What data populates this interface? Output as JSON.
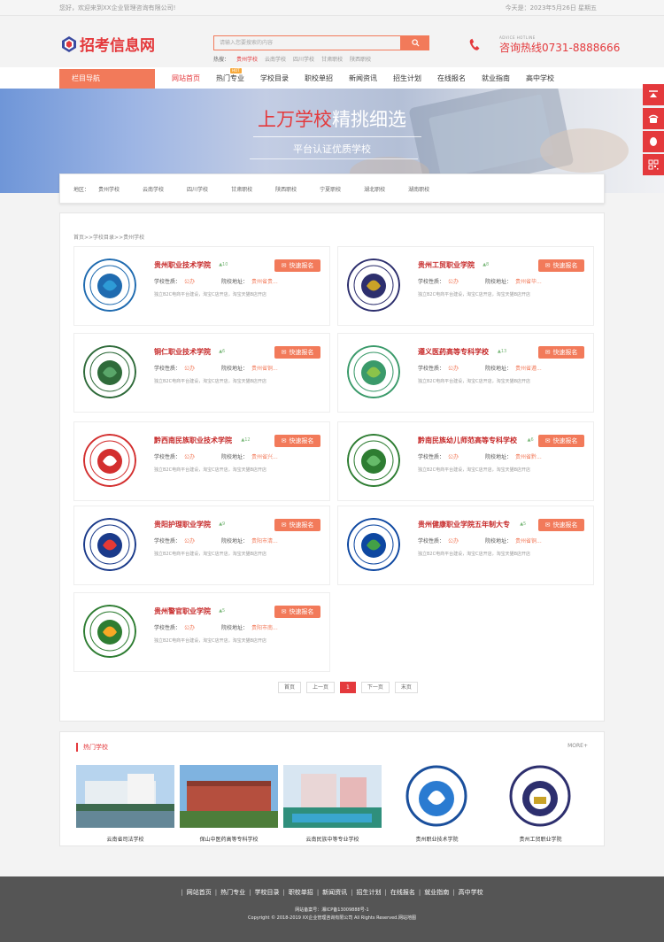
{
  "topbar": {
    "welcome": "您好，欢迎来到XX企业管理咨询有限公司!",
    "date": "今天是：2023年5月26日 星期五"
  },
  "logo": {
    "text": "招考信息网"
  },
  "search": {
    "placeholder": "请输入您要搜索的内容",
    "hot_label": "热搜：",
    "hot_items": [
      "贵州学校",
      "云南学校",
      "四川学校",
      "甘肃职校",
      "陕西职校"
    ]
  },
  "phone": {
    "small": "ADVICE HOTLINE",
    "label": "咨询热线",
    "number": "0731-8888666"
  },
  "nav": {
    "side_label": "栏目导航",
    "hot_badge": "HOT",
    "items": [
      "网站首页",
      "热门专业",
      "学校目录",
      "职校单招",
      "新闻资讯",
      "招生计划",
      "在线报名",
      "就业指南",
      "高中学校"
    ]
  },
  "banner": {
    "title_red": "上万学校",
    "title_white": "精挑细选",
    "subtitle": "平台认证优质学校"
  },
  "region": {
    "label": "地区：",
    "items": [
      "贵州学校",
      "云南学校",
      "四川学校",
      "甘肃职校",
      "陕西职校",
      "宁夏职校",
      "湖北职校",
      "湖南职校"
    ]
  },
  "breadcrumb": "首页>>学校目录>>贵州学校",
  "card_labels": {
    "button": "快速报名",
    "nature": "学校性质：",
    "address": "院校地址：",
    "desc": "独立B2C电商平台建设，淘宝C店开店，淘宝天猫B店开店"
  },
  "schools": [
    {
      "name": "贵州职业技术学院",
      "count": "10",
      "nature": "公办",
      "address": "贵州省贵..."
    },
    {
      "name": "贵州工贸职业学院",
      "count": "8",
      "nature": "公办",
      "address": "贵州省毕..."
    },
    {
      "name": "铜仁职业技术学院",
      "count": "6",
      "nature": "公办",
      "address": "贵州省铜..."
    },
    {
      "name": "遵义医药高等专科学校",
      "count": "13",
      "nature": "公办",
      "address": "贵州省遵..."
    },
    {
      "name": "黔西南民族职业技术学院",
      "count": "12",
      "nature": "公办",
      "address": "贵州省兴..."
    },
    {
      "name": "黔南民族幼儿师范高等专科学校",
      "count": "6",
      "nature": "公办",
      "address": "贵州省黔..."
    },
    {
      "name": "贵阳护理职业学院",
      "count": "9",
      "nature": "公办",
      "address": "贵阳市清..."
    },
    {
      "name": "贵州健康职业学院五年制大专",
      "count": "5",
      "nature": "公办",
      "address": "贵州省铜..."
    },
    {
      "name": "贵州警官职业学院",
      "count": "5",
      "nature": "公办",
      "address": "贵阳市南..."
    }
  ],
  "pager": [
    "首页",
    "上一页",
    "1",
    "下一页",
    "末页"
  ],
  "hot_schools": {
    "title": "热门学校",
    "more": "MORE+",
    "items": [
      "云南省司法学校",
      "保山中医药高等专科学校",
      "云南民族中等专业学校",
      "贵州职业技术学院",
      "贵州工贸职业学院"
    ]
  },
  "footer": {
    "links": [
      "网站首页",
      "热门专业",
      "学校目录",
      "职校单招",
      "新闻资讯",
      "招生计划",
      "在线报名",
      "就业指南",
      "高中学校"
    ],
    "icp": "网站备案号：湘ICP备13009888号-1",
    "copyright": "Copyright © 2018-2019 XX企业管理咨询有限公司 All Rights Reserved.网站地图"
  },
  "colors": {
    "accent": "#e4393c",
    "button": "#f27a5a",
    "footer": "#555555"
  }
}
